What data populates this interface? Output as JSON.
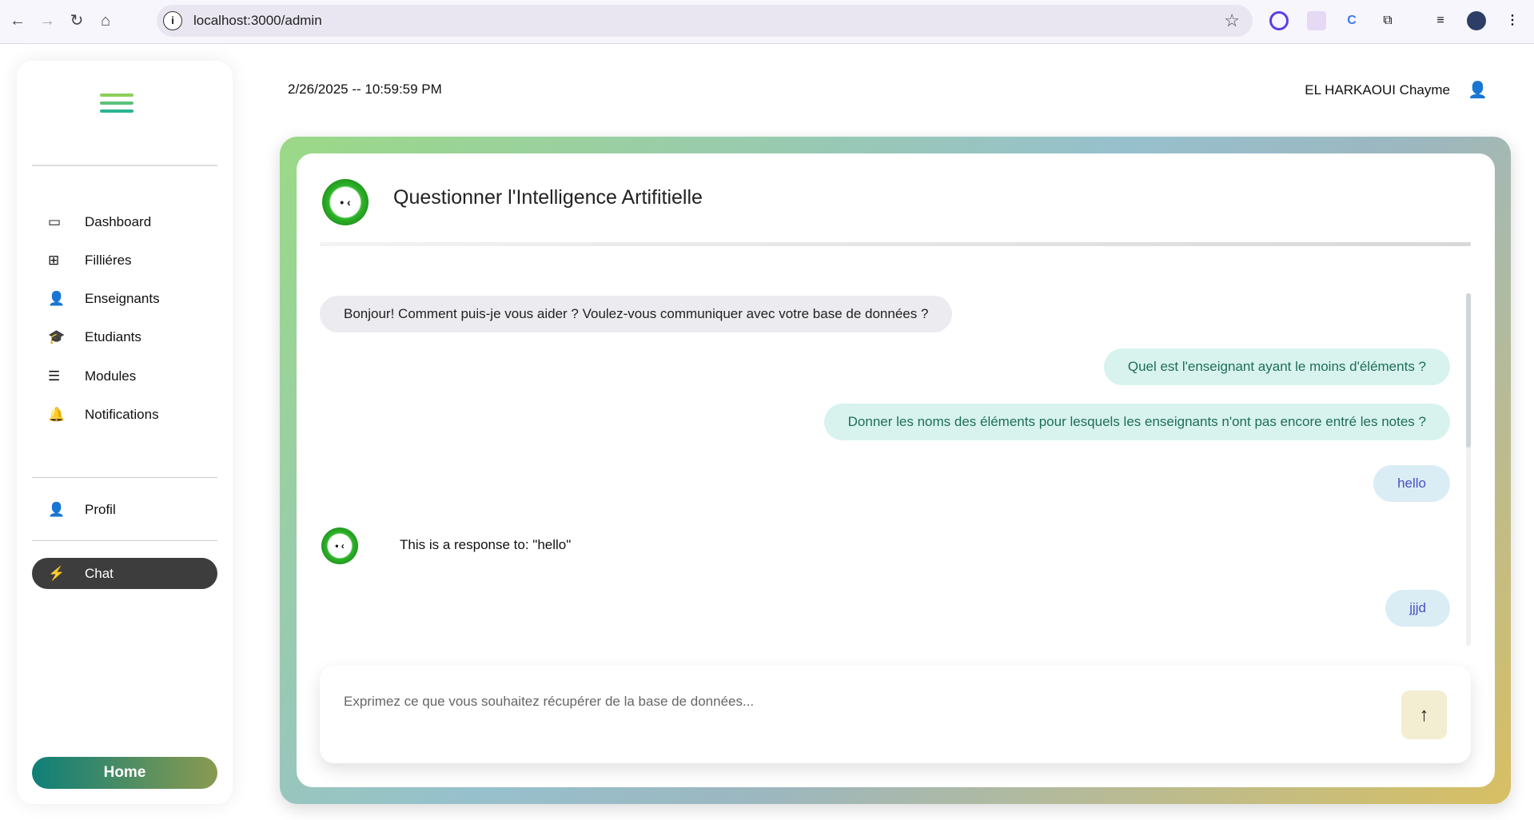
{
  "browser": {
    "url": "localhost:3000/admin"
  },
  "sidebar": {
    "items": [
      {
        "label": "Dashboard",
        "icon": "laptop-icon"
      },
      {
        "label": "Filliéres",
        "icon": "grid-icon"
      },
      {
        "label": "Enseignants",
        "icon": "teacher-icon"
      },
      {
        "label": "Etudiants",
        "icon": "graduate-icon"
      },
      {
        "label": "Modules",
        "icon": "layers-icon"
      },
      {
        "label": "Notifications",
        "icon": "bell-icon"
      }
    ],
    "profile": "Profil",
    "chat": "Chat",
    "home": "Home"
  },
  "header": {
    "datetime": "2/26/2025 -- 10:59:59 PM",
    "user": "EL HARKAOUI Chayme"
  },
  "chat": {
    "title": "Questionner l'Intelligence Artifitielle",
    "greeting": "Bonjour! Comment puis-je vous aider ? Voulez-vous communiquer avec votre base de données ?",
    "suggestions": [
      "Quel est l'enseignant ayant le moins d'éléments ?",
      "Donner les noms des éléments pour lesquels les enseignants n'ont pas encore entré les notes ?"
    ],
    "user_msg_1": "hello",
    "bot_reply_1": "This is a response to: \"hello\"",
    "user_msg_2": "jjjd",
    "placeholder": "Exprimez ce que vous souhaitez récupérer de la base de données..."
  },
  "colors": {
    "accent_green": "#2fb52a",
    "active": "#3d3d3d"
  }
}
